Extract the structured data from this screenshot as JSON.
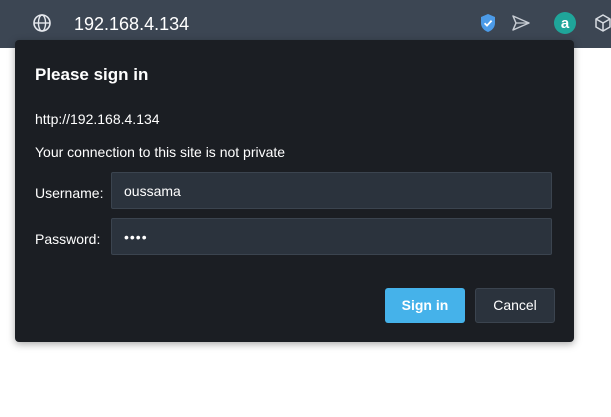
{
  "browser": {
    "address": "192.168.4.134",
    "icons": [
      "globe-icon",
      "shield-check-icon",
      "send-icon",
      "amazon-assistant-icon",
      "cube-extension-icon"
    ]
  },
  "dialog": {
    "title": "Please sign in",
    "url": "http://192.168.4.134",
    "warning": "Your connection to this site is not private",
    "username_label": "Username:",
    "username_value": "oussama",
    "password_label": "Password:",
    "password_value": "••••",
    "signin_label": "Sign in",
    "cancel_label": "Cancel"
  },
  "colors": {
    "toolbar": "#3c4653",
    "dialog_bg": "#1b1e23",
    "input_bg": "#2b333d",
    "primary_button": "#45b2ea",
    "shield": "#4c9be8",
    "amazon_badge": "#1fa59a"
  }
}
